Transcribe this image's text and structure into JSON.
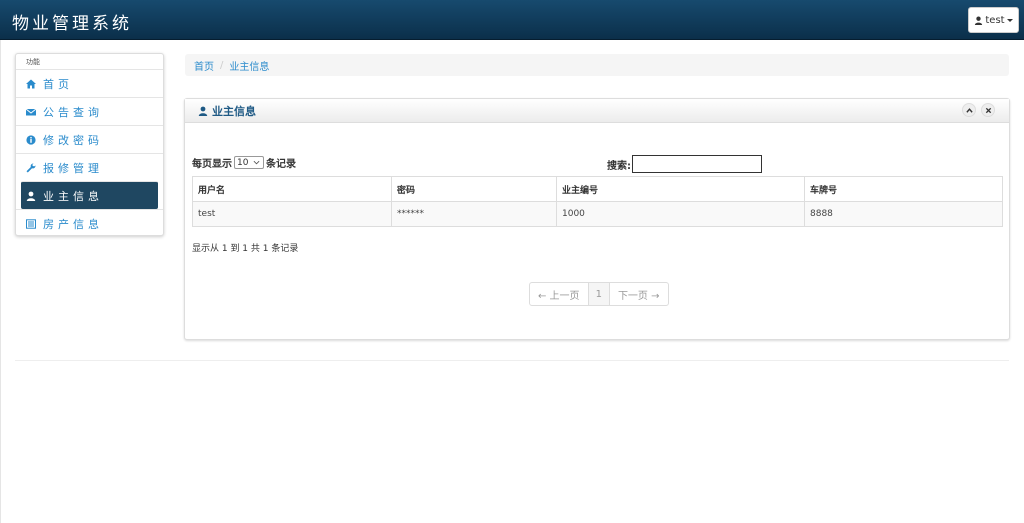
{
  "app": {
    "title": "物业管理系统"
  },
  "user": {
    "name": "test"
  },
  "sidebar": {
    "header": "功能",
    "items": [
      {
        "label": "首页",
        "icon": "home-icon"
      },
      {
        "label": "公告查询",
        "icon": "envelope-icon"
      },
      {
        "label": "修改密码",
        "icon": "info-icon"
      },
      {
        "label": "报修管理",
        "icon": "wrench-icon"
      },
      {
        "label": "业主信息",
        "icon": "user-icon",
        "active": true
      },
      {
        "label": "房产信息",
        "icon": "list-icon"
      }
    ]
  },
  "breadcrumb": {
    "items": [
      "首页",
      "业主信息"
    ]
  },
  "panel": {
    "title": "业主信息"
  },
  "table_controls": {
    "length_prefix": "每页显示",
    "length_value": "10",
    "length_suffix": "条记录",
    "search_label": "搜索:",
    "search_value": ""
  },
  "table": {
    "columns": [
      "用户名",
      "密码",
      "业主编号",
      "车牌号"
    ],
    "rows": [
      [
        "test",
        "******",
        "1000",
        "8888"
      ]
    ]
  },
  "info": "显示从 1 到 1 共 1 条记录",
  "pagination": {
    "prev": "← 上一页",
    "current": "1",
    "next": "下一页 →"
  },
  "colors": {
    "navbar": "#0b2f4a",
    "accent": "#2a8bcc",
    "active_item": "#1f4761"
  }
}
